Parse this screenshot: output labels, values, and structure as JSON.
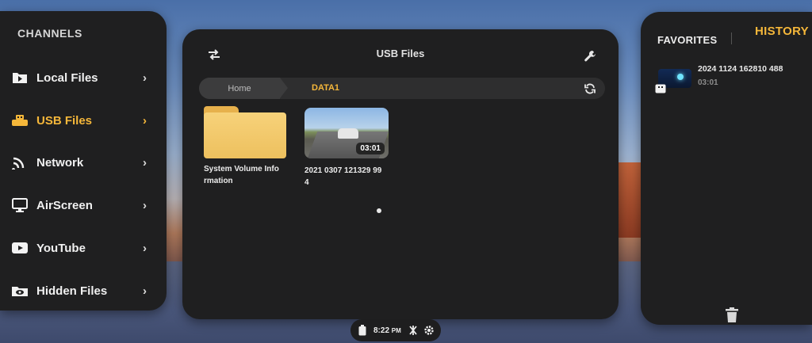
{
  "channels": {
    "heading": "CHANNELS",
    "items": [
      {
        "label": "Local Files",
        "icon": "folder-play-icon",
        "active": false
      },
      {
        "label": "USB Files",
        "icon": "usb-drive-icon",
        "active": true
      },
      {
        "label": "Network",
        "icon": "wifi-icon",
        "active": false
      },
      {
        "label": "AirScreen",
        "icon": "monitor-icon",
        "active": false
      },
      {
        "label": "YouTube",
        "icon": "youtube-icon",
        "active": false
      },
      {
        "label": "Hidden Files",
        "icon": "hidden-eye-icon",
        "active": false
      }
    ],
    "arrow": "›"
  },
  "usb": {
    "title": "USB Files",
    "breadcrumb": {
      "home": "Home",
      "current": "DATA1"
    },
    "files": [
      {
        "type": "folder",
        "name": "System Volume Information",
        "name_line1": "System Volume Info",
        "name_line2": "rmation"
      },
      {
        "type": "video",
        "name_line1": "2021 0307 121329 99",
        "name_line2": "4",
        "duration": "03:01"
      }
    ]
  },
  "sidepanel": {
    "tabs": {
      "favorites": "FAVORITES",
      "history": "HISTORY"
    },
    "active_tab": "HISTORY",
    "history": [
      {
        "name": "2024 1124 162810 488",
        "duration": "03:01"
      }
    ]
  },
  "statusbar": {
    "time": "8:22",
    "ampm": "PM"
  },
  "colors": {
    "accent": "#f5b73a",
    "panel": "#1f1f20"
  }
}
